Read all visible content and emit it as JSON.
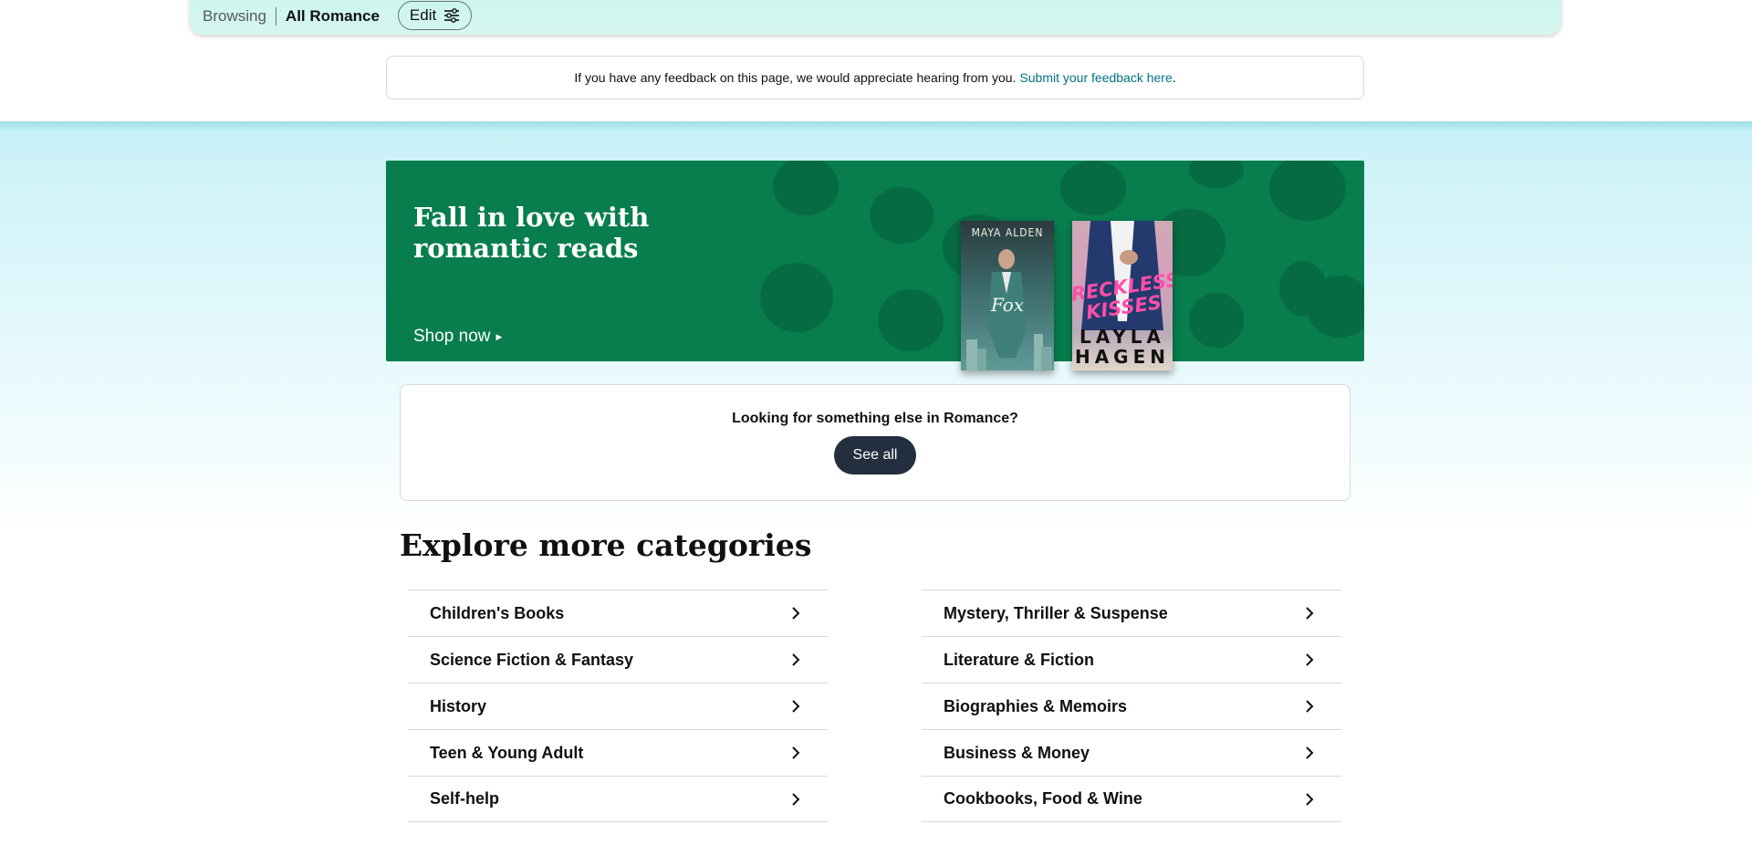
{
  "browse_bar": {
    "browsing_label": "Browsing",
    "current_label": "All Romance",
    "edit_label": "Edit"
  },
  "feedback": {
    "text": "If you have any feedback on this page, we would appreciate hearing from you.",
    "link_label": "Submit your feedback here",
    "suffix": "."
  },
  "banner": {
    "title": "Fall in love with romantic reads",
    "cta": "Shop now",
    "bg_color": "#087d4d",
    "books": [
      {
        "author": "MAYA ALDEN",
        "title": "Fox"
      },
      {
        "title": "RECKLESS KISSES",
        "author": "LAYLA HAGEN"
      }
    ]
  },
  "looking": {
    "question": "Looking for something else in Romance?",
    "button_label": "See all"
  },
  "explore": {
    "title": "Explore more categories",
    "left": [
      "Children's Books",
      "Science Fiction & Fantasy",
      "History",
      "Teen & Young Adult",
      "Self-help"
    ],
    "right": [
      "Mystery, Thriller & Suspense",
      "Literature & Fiction",
      "Biographies & Memoirs",
      "Business & Money",
      "Cookbooks, Food & Wine"
    ]
  }
}
